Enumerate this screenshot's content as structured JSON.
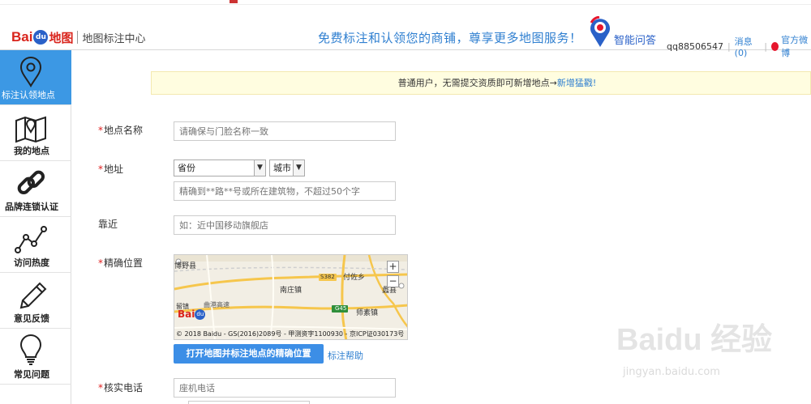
{
  "header": {
    "logo_bai": "Bai",
    "logo_paw": "du",
    "logo_map": "地图",
    "logo_subtitle": "地图标注中心",
    "slogan": "免费标注和认领您的商铺，尊享更多地图服务！",
    "qa_label": "智能问答",
    "username": "qq88506547",
    "messages": "消息(0)",
    "weibo": "官方微博"
  },
  "sidebar": {
    "items": [
      {
        "label": "标注认领地点",
        "icon": "location-pin-icon",
        "active": true
      },
      {
        "label": "我的地点",
        "icon": "folded-map-icon",
        "active": false
      },
      {
        "label": "品牌连锁认证",
        "icon": "chain-link-icon",
        "active": false
      },
      {
        "label": "访问热度",
        "icon": "line-chart-icon",
        "active": false
      },
      {
        "label": "意见反馈",
        "icon": "pencil-icon",
        "active": false
      },
      {
        "label": "常见问题",
        "icon": "lightbulb-icon",
        "active": false
      }
    ]
  },
  "notice": {
    "text": "普通用户，无需提交资质即可新增地点→",
    "link": "新增猛戳!"
  },
  "form": {
    "name": {
      "label": "地点名称",
      "placeholder": "请确保与门脸名称一致"
    },
    "address": {
      "label": "地址",
      "province": "省份",
      "city": "城市",
      "detail_placeholder": "精确到**路**号或所在建筑物，不超过50个字"
    },
    "nearby": {
      "label": "靠近",
      "placeholder": "如：近中国移动旗舰店"
    },
    "location": {
      "label": "精确位置",
      "map_labels": [
        "博野县",
        "付佐乡",
        "S382",
        "南庄镇",
        "蠡县",
        "曲港高速",
        "G45",
        "师素镇",
        "留镇"
      ],
      "map_logo_bai": "Bai",
      "map_logo_paw": "du",
      "copyright": "© 2018 Baidu - GS(2016)2089号 - 甲测资字1100930 - 京ICP证030173号",
      "open_button": "打开地图并标注地点的精确位置",
      "help_link": "标注帮助"
    },
    "phone": {
      "label": "核实电话",
      "placeholder": "座机电话"
    }
  },
  "watermark": {
    "brand": "Baidu 经验",
    "url": "jingyan.baidu.com"
  }
}
